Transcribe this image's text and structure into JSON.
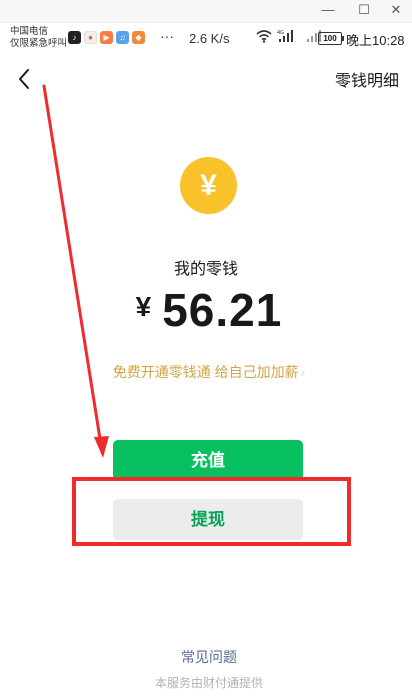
{
  "window": {
    "minimize_glyph": "—",
    "maximize_glyph": "☐",
    "close_glyph": "✕"
  },
  "status_bar": {
    "carrier_line1": "中国电信",
    "carrier_line2": "仅限紧急呼叫",
    "more_indicator": "···",
    "net_speed": "2.6 K/s",
    "battery": "100",
    "time": "晚上10:28",
    "app_icons": [
      "tiktok-icon",
      "video-app-icon",
      "player-app-icon",
      "music-app-icon",
      "store-app-icon"
    ]
  },
  "nav": {
    "back_icon": "chevron-left-icon",
    "action_label": "零钱明细"
  },
  "wallet": {
    "icon_glyph": "¥",
    "title": "我的零钱",
    "currency": "¥",
    "amount": "56.21",
    "promo_text": "免费开通零钱通 给自己加加薪",
    "promo_chevron": "›"
  },
  "actions": {
    "recharge_label": "充值",
    "withdraw_label": "提现"
  },
  "footer": {
    "faq_label": "常见问题",
    "provider_text": "本服务由财付通提供"
  },
  "colors": {
    "accent_green": "#07c160",
    "yen_circle": "#f9c12a",
    "promo_gold": "#d4a441",
    "annotation_red": "#ef2b2b"
  }
}
